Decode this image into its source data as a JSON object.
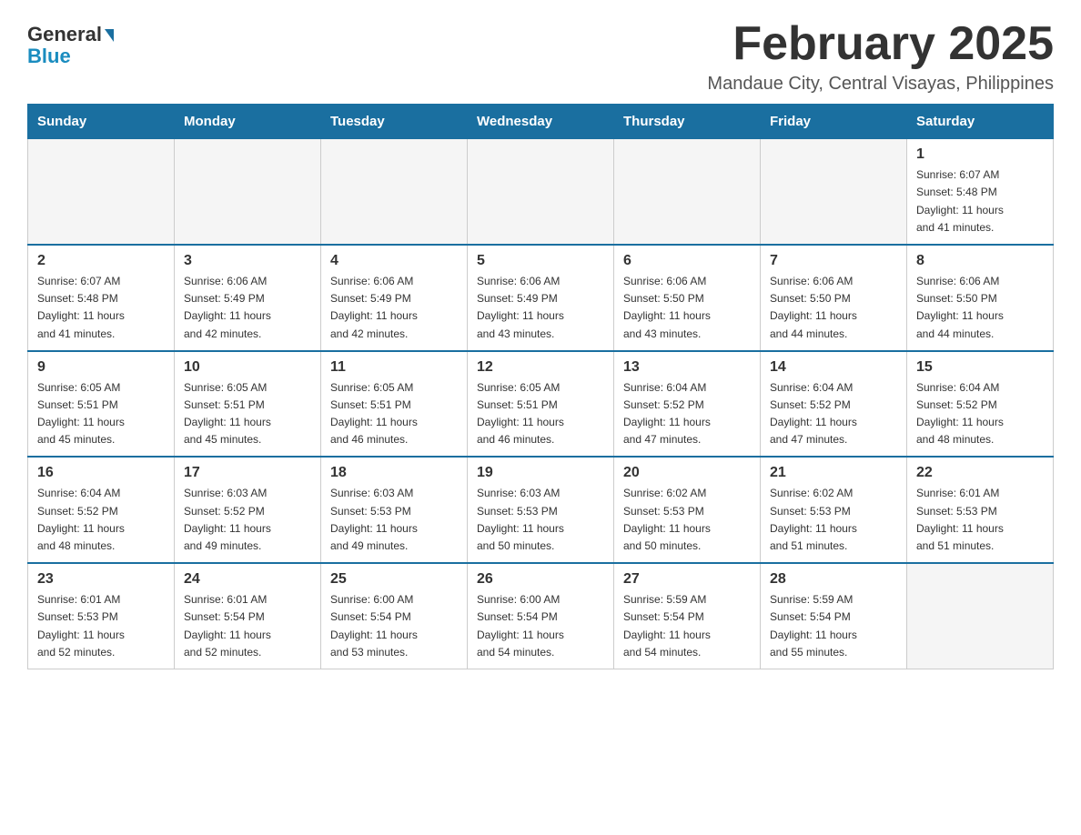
{
  "header": {
    "logo_general": "General",
    "logo_blue": "Blue",
    "main_title": "February 2025",
    "subtitle": "Mandaue City, Central Visayas, Philippines"
  },
  "days_of_week": [
    "Sunday",
    "Monday",
    "Tuesday",
    "Wednesday",
    "Thursday",
    "Friday",
    "Saturday"
  ],
  "weeks": [
    [
      {
        "day": "",
        "info": "",
        "empty": true
      },
      {
        "day": "",
        "info": "",
        "empty": true
      },
      {
        "day": "",
        "info": "",
        "empty": true
      },
      {
        "day": "",
        "info": "",
        "empty": true
      },
      {
        "day": "",
        "info": "",
        "empty": true
      },
      {
        "day": "",
        "info": "",
        "empty": true
      },
      {
        "day": "1",
        "info": "Sunrise: 6:07 AM\nSunset: 5:48 PM\nDaylight: 11 hours\nand 41 minutes."
      }
    ],
    [
      {
        "day": "2",
        "info": "Sunrise: 6:07 AM\nSunset: 5:48 PM\nDaylight: 11 hours\nand 41 minutes."
      },
      {
        "day": "3",
        "info": "Sunrise: 6:06 AM\nSunset: 5:49 PM\nDaylight: 11 hours\nand 42 minutes."
      },
      {
        "day": "4",
        "info": "Sunrise: 6:06 AM\nSunset: 5:49 PM\nDaylight: 11 hours\nand 42 minutes."
      },
      {
        "day": "5",
        "info": "Sunrise: 6:06 AM\nSunset: 5:49 PM\nDaylight: 11 hours\nand 43 minutes."
      },
      {
        "day": "6",
        "info": "Sunrise: 6:06 AM\nSunset: 5:50 PM\nDaylight: 11 hours\nand 43 minutes."
      },
      {
        "day": "7",
        "info": "Sunrise: 6:06 AM\nSunset: 5:50 PM\nDaylight: 11 hours\nand 44 minutes."
      },
      {
        "day": "8",
        "info": "Sunrise: 6:06 AM\nSunset: 5:50 PM\nDaylight: 11 hours\nand 44 minutes."
      }
    ],
    [
      {
        "day": "9",
        "info": "Sunrise: 6:05 AM\nSunset: 5:51 PM\nDaylight: 11 hours\nand 45 minutes."
      },
      {
        "day": "10",
        "info": "Sunrise: 6:05 AM\nSunset: 5:51 PM\nDaylight: 11 hours\nand 45 minutes."
      },
      {
        "day": "11",
        "info": "Sunrise: 6:05 AM\nSunset: 5:51 PM\nDaylight: 11 hours\nand 46 minutes."
      },
      {
        "day": "12",
        "info": "Sunrise: 6:05 AM\nSunset: 5:51 PM\nDaylight: 11 hours\nand 46 minutes."
      },
      {
        "day": "13",
        "info": "Sunrise: 6:04 AM\nSunset: 5:52 PM\nDaylight: 11 hours\nand 47 minutes."
      },
      {
        "day": "14",
        "info": "Sunrise: 6:04 AM\nSunset: 5:52 PM\nDaylight: 11 hours\nand 47 minutes."
      },
      {
        "day": "15",
        "info": "Sunrise: 6:04 AM\nSunset: 5:52 PM\nDaylight: 11 hours\nand 48 minutes."
      }
    ],
    [
      {
        "day": "16",
        "info": "Sunrise: 6:04 AM\nSunset: 5:52 PM\nDaylight: 11 hours\nand 48 minutes."
      },
      {
        "day": "17",
        "info": "Sunrise: 6:03 AM\nSunset: 5:52 PM\nDaylight: 11 hours\nand 49 minutes."
      },
      {
        "day": "18",
        "info": "Sunrise: 6:03 AM\nSunset: 5:53 PM\nDaylight: 11 hours\nand 49 minutes."
      },
      {
        "day": "19",
        "info": "Sunrise: 6:03 AM\nSunset: 5:53 PM\nDaylight: 11 hours\nand 50 minutes."
      },
      {
        "day": "20",
        "info": "Sunrise: 6:02 AM\nSunset: 5:53 PM\nDaylight: 11 hours\nand 50 minutes."
      },
      {
        "day": "21",
        "info": "Sunrise: 6:02 AM\nSunset: 5:53 PM\nDaylight: 11 hours\nand 51 minutes."
      },
      {
        "day": "22",
        "info": "Sunrise: 6:01 AM\nSunset: 5:53 PM\nDaylight: 11 hours\nand 51 minutes."
      }
    ],
    [
      {
        "day": "23",
        "info": "Sunrise: 6:01 AM\nSunset: 5:53 PM\nDaylight: 11 hours\nand 52 minutes."
      },
      {
        "day": "24",
        "info": "Sunrise: 6:01 AM\nSunset: 5:54 PM\nDaylight: 11 hours\nand 52 minutes."
      },
      {
        "day": "25",
        "info": "Sunrise: 6:00 AM\nSunset: 5:54 PM\nDaylight: 11 hours\nand 53 minutes."
      },
      {
        "day": "26",
        "info": "Sunrise: 6:00 AM\nSunset: 5:54 PM\nDaylight: 11 hours\nand 54 minutes."
      },
      {
        "day": "27",
        "info": "Sunrise: 5:59 AM\nSunset: 5:54 PM\nDaylight: 11 hours\nand 54 minutes."
      },
      {
        "day": "28",
        "info": "Sunrise: 5:59 AM\nSunset: 5:54 PM\nDaylight: 11 hours\nand 55 minutes."
      },
      {
        "day": "",
        "info": "",
        "empty": true
      }
    ]
  ]
}
